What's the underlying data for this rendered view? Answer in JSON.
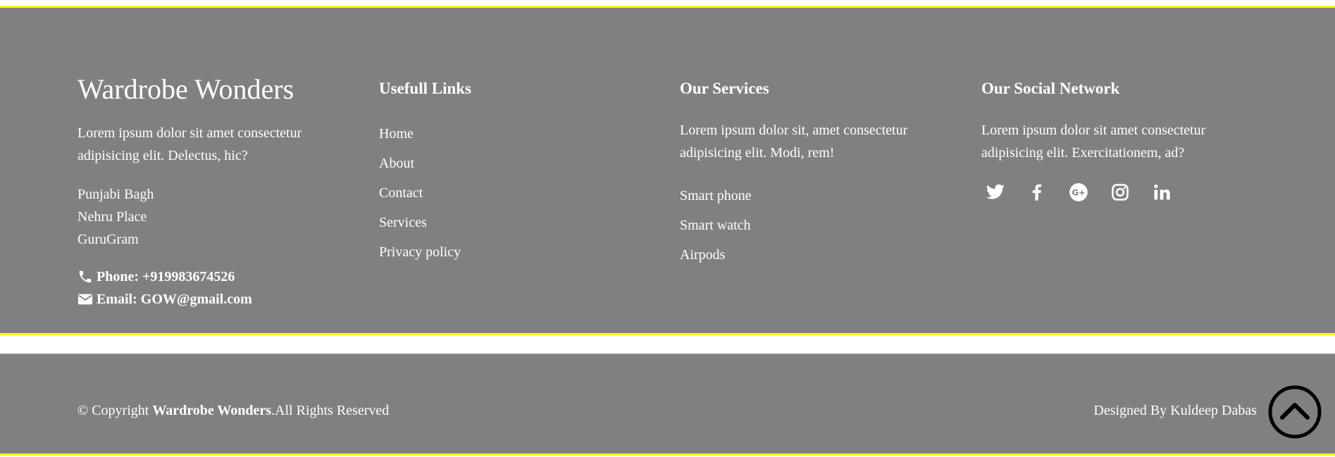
{
  "about": {
    "brand": "Wardrobe Wonders",
    "description": "Lorem ipsum dolor sit amet consectetur adipisicing elit. Delectus, hic?",
    "address": [
      "Punjabi Bagh",
      "Nehru Place",
      "GuruGram"
    ],
    "phone_label": "Phone:",
    "phone": "+919983674526",
    "email_label": "Email:",
    "email": "GOW@gmail.com"
  },
  "links": {
    "heading": "Usefull Links",
    "items": [
      "Home",
      "About",
      "Contact",
      "Services",
      "Privacy policy"
    ]
  },
  "services": {
    "heading": "Our Services",
    "description": "Lorem ipsum dolor sit, amet consectetur adipisicing elit. Modi, rem!",
    "items": [
      "Smart phone",
      "Smart watch",
      "Airpods"
    ]
  },
  "social": {
    "heading": "Our Social Network",
    "description": "Lorem ipsum dolor sit amet consectetur adipisicing elit. Exercitationem, ad?",
    "icons": [
      "twitter-icon",
      "facebook-icon",
      "google-plus-icon",
      "instagram-icon",
      "linkedin-icon"
    ]
  },
  "bottom": {
    "copyright_prefix": "© Copyright ",
    "copyright_brand": "Wardrobe Wonders",
    "copyright_suffix": ".All Rights Reserved",
    "designed_by": "Designed By Kuldeep Dabas"
  },
  "colors": {
    "background": "#808080",
    "accent_border": "#ffff00",
    "text": "#ffffff"
  }
}
